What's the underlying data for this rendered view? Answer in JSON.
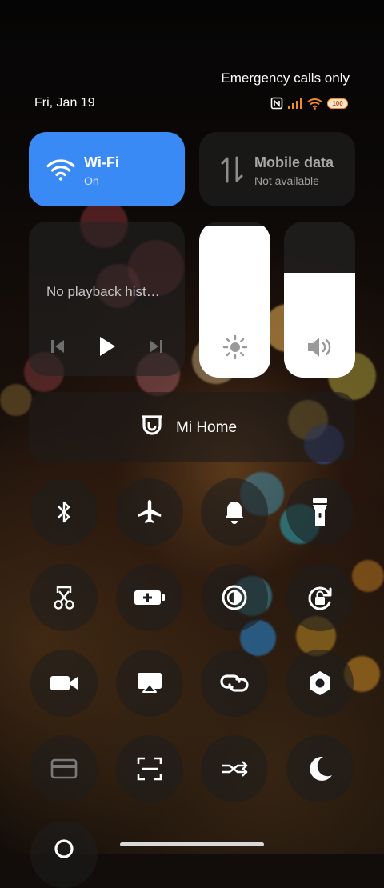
{
  "status_bar": {
    "carrier_text": "Emergency calls only",
    "date": "Fri, Jan 19",
    "battery": "100",
    "icons": [
      "nfc-icon",
      "signal-icon",
      "wifi-icon",
      "battery-icon"
    ]
  },
  "tiles": {
    "wifi": {
      "title": "Wi-Fi",
      "status": "On",
      "icon": "wifi-icon",
      "color": "#3a8af5"
    },
    "mobile_data": {
      "title": "Mobile data",
      "status": "Not available",
      "icon": "mobile-data-icon"
    }
  },
  "media": {
    "text": "No playback hist…",
    "controls": [
      "previous-icon",
      "play-icon",
      "next-icon"
    ]
  },
  "sliders": {
    "brightness": {
      "icon": "brightness-icon",
      "level": 0.97
    },
    "volume": {
      "icon": "volume-icon",
      "level": 0.67
    }
  },
  "mi_home": {
    "label": "Mi Home",
    "icon": "mi-home-icon"
  },
  "toggles": [
    {
      "icon": "bluetooth-icon"
    },
    {
      "icon": "airplane-icon"
    },
    {
      "icon": "bell-icon"
    },
    {
      "icon": "flashlight-icon"
    },
    {
      "icon": "screenshot-icon"
    },
    {
      "icon": "battery-saver-icon"
    },
    {
      "icon": "dark-mode-icon"
    },
    {
      "icon": "rotation-lock-icon"
    },
    {
      "icon": "video-camera-icon"
    },
    {
      "icon": "cast-icon"
    },
    {
      "icon": "link-icon"
    },
    {
      "icon": "settings-hex-icon"
    },
    {
      "icon": "card-icon"
    },
    {
      "icon": "scanner-icon"
    },
    {
      "icon": "sync-icon"
    },
    {
      "icon": "moon-icon"
    },
    {
      "icon": "location-icon"
    }
  ]
}
